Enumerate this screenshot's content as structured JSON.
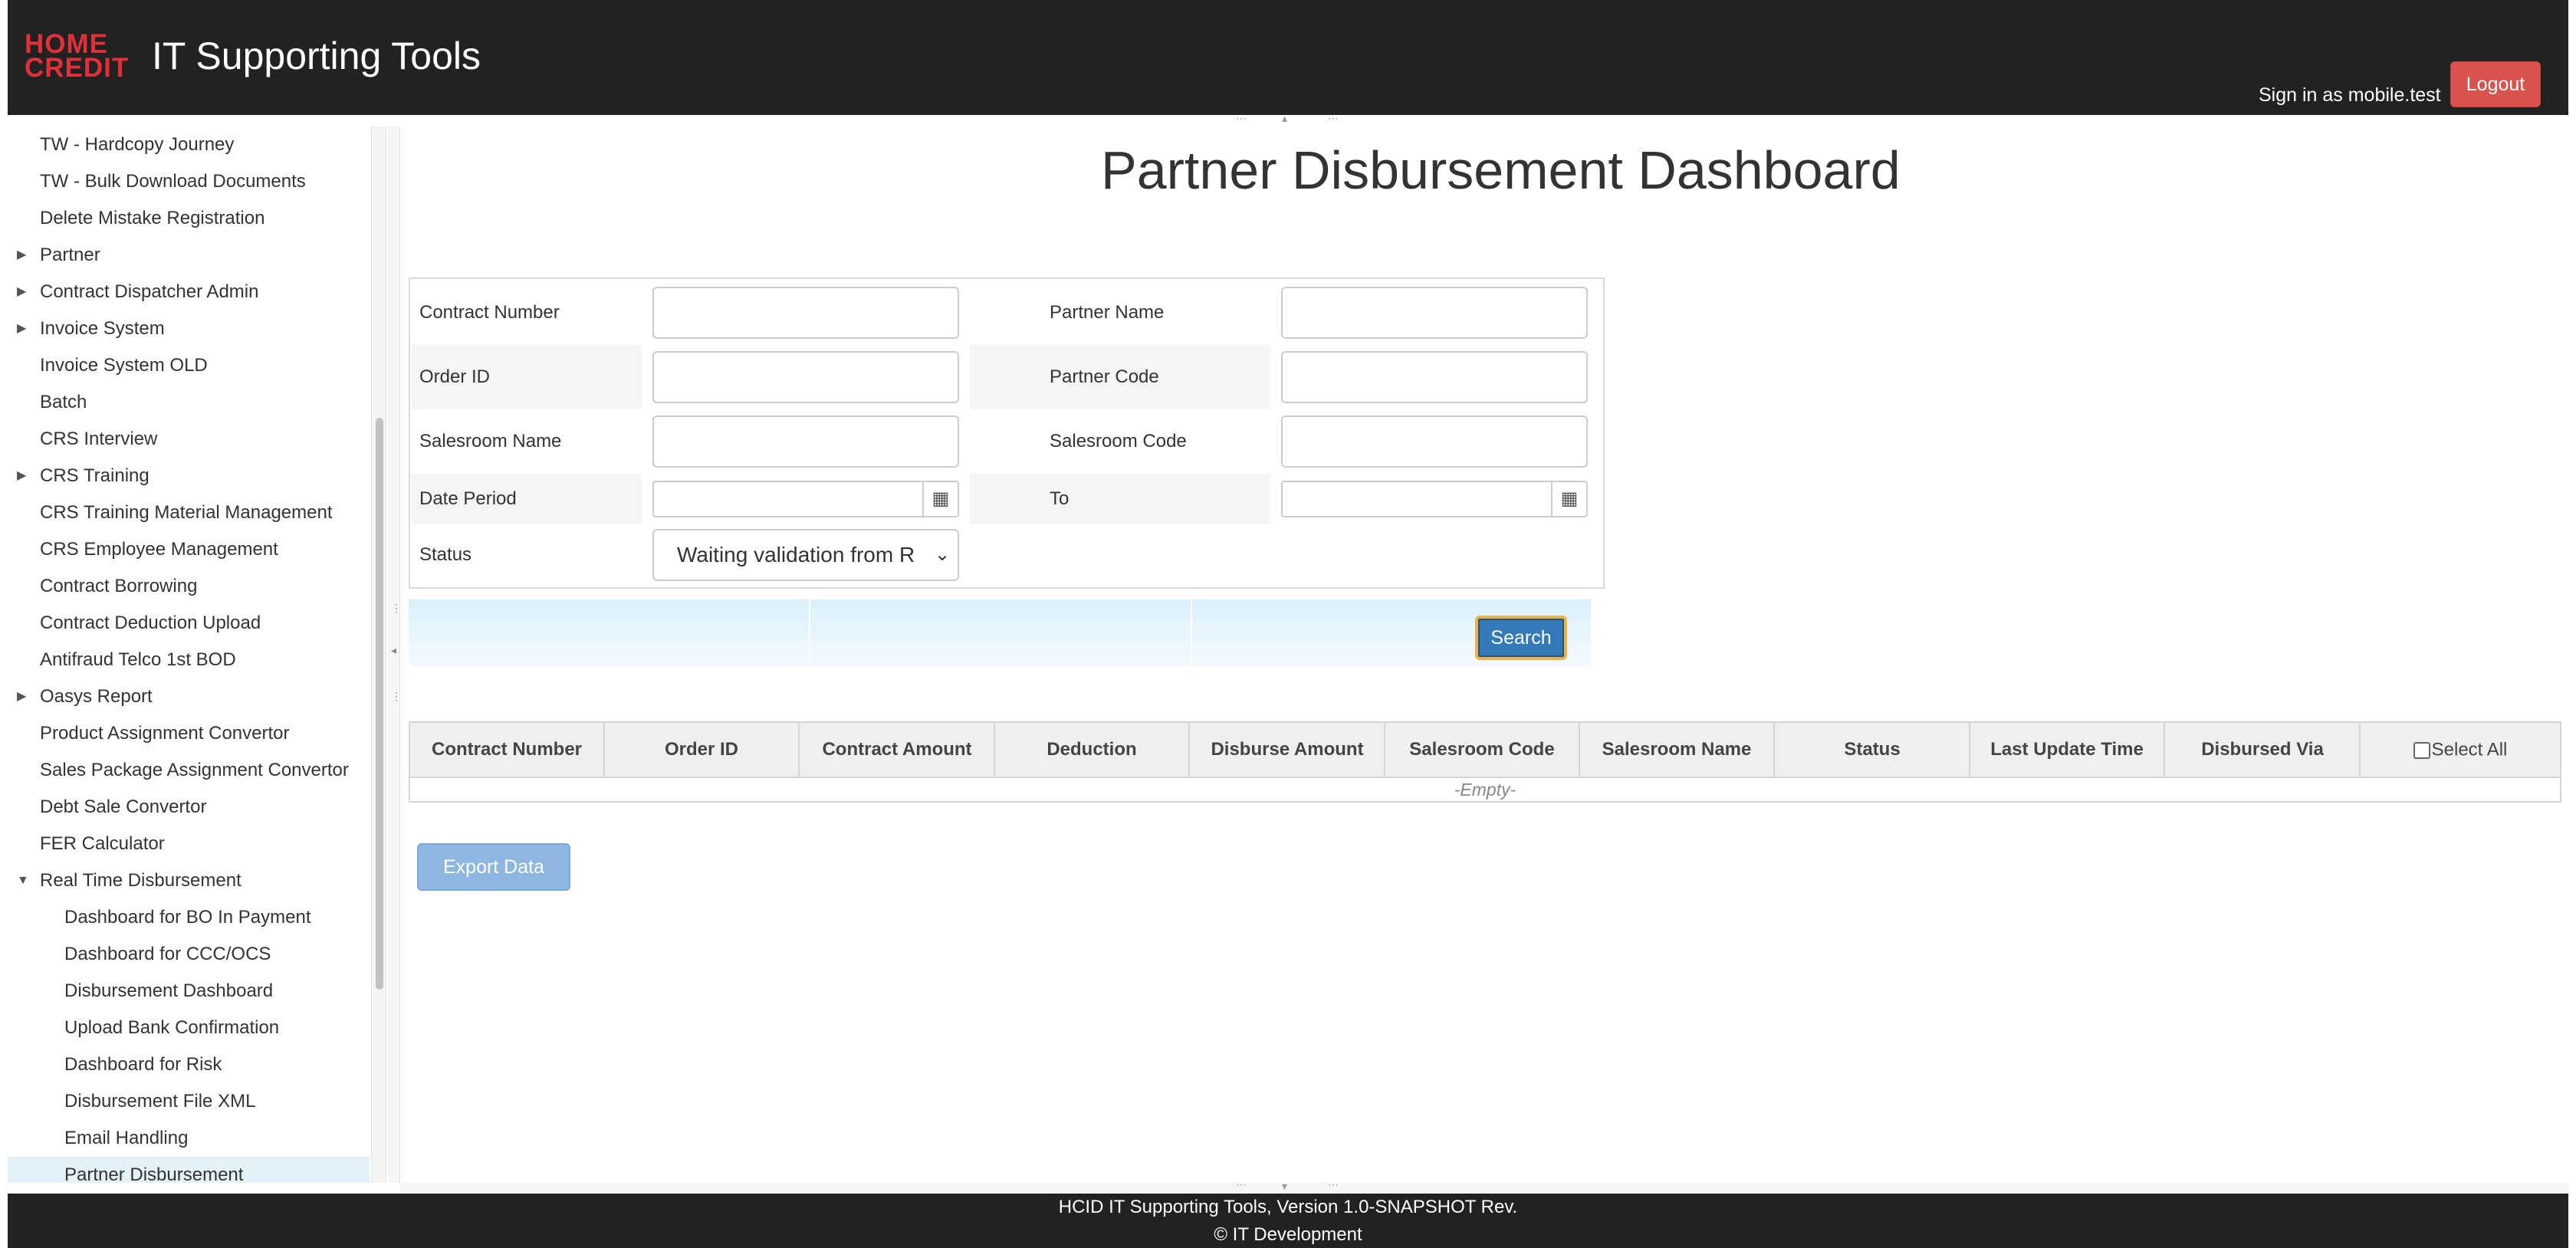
{
  "header": {
    "logo_line1": "HOME",
    "logo_line2": "CREDIT",
    "app_title": "IT Supporting Tools",
    "signin_text": "Sign in as mobile.test",
    "logout_label": "Logout"
  },
  "sidebar": {
    "items": [
      {
        "label": "TW - Hardcopy Journey",
        "expandable": false
      },
      {
        "label": "TW - Bulk Download Documents",
        "expandable": false
      },
      {
        "label": "Delete Mistake Registration",
        "expandable": false
      },
      {
        "label": "Partner",
        "expandable": true
      },
      {
        "label": "Contract Dispatcher Admin",
        "expandable": true
      },
      {
        "label": "Invoice System",
        "expandable": true
      },
      {
        "label": "Invoice System OLD",
        "expandable": false
      },
      {
        "label": "Batch",
        "expandable": false
      },
      {
        "label": "CRS Interview",
        "expandable": false
      },
      {
        "label": "CRS Training",
        "expandable": true
      },
      {
        "label": "CRS Training Material Management",
        "expandable": false
      },
      {
        "label": "CRS Employee Management",
        "expandable": false
      },
      {
        "label": "Contract Borrowing",
        "expandable": false
      },
      {
        "label": "Contract Deduction Upload",
        "expandable": false
      },
      {
        "label": "Antifraud Telco 1st BOD",
        "expandable": false
      },
      {
        "label": "Oasys Report",
        "expandable": true
      },
      {
        "label": "Product Assignment Convertor",
        "expandable": false
      },
      {
        "label": "Sales Package Assignment Convertor",
        "expandable": false
      },
      {
        "label": "Debt Sale Convertor",
        "expandable": false
      },
      {
        "label": "FER Calculator",
        "expandable": false
      },
      {
        "label": "Real Time Disbursement",
        "expandable": true,
        "expanded": true
      },
      {
        "label": "Dashboard for BO In Payment",
        "child": true
      },
      {
        "label": "Dashboard for CCC/OCS",
        "child": true
      },
      {
        "label": "Disbursement Dashboard",
        "child": true
      },
      {
        "label": "Upload Bank Confirmation",
        "child": true
      },
      {
        "label": "Dashboard for Risk",
        "child": true
      },
      {
        "label": "Disbursement File XML",
        "child": true
      },
      {
        "label": "Email Handling",
        "child": true
      },
      {
        "label": "Partner Disbursement",
        "child": true,
        "selected": true
      }
    ]
  },
  "main": {
    "title": "Partner Disbursement Dashboard",
    "form": {
      "contract_number_label": "Contract Number",
      "contract_number_value": "",
      "partner_name_label": "Partner Name",
      "partner_name_value": "",
      "order_id_label": "Order ID",
      "order_id_value": "",
      "partner_code_label": "Partner Code",
      "partner_code_value": "",
      "salesroom_name_label": "Salesroom Name",
      "salesroom_name_value": "",
      "salesroom_code_label": "Salesroom Code",
      "salesroom_code_value": "",
      "date_period_label": "Date Period",
      "date_from_value": "",
      "to_label": "To",
      "date_to_value": "",
      "status_label": "Status",
      "status_selected": "Waiting validation from R"
    },
    "search_label": "Search",
    "grid": {
      "columns": [
        "Contract Number",
        "Order ID",
        "Contract Amount",
        "Deduction",
        "Disburse Amount",
        "Salesroom Code",
        "Salesroom Name",
        "Status",
        "Last Update Time",
        "Disbursed Via"
      ],
      "select_all_label": "Select All",
      "empty_text": "-Empty-"
    },
    "export_label": "Export Data"
  },
  "footer": {
    "line1": "HCID IT Supporting Tools, Version 1.0-SNAPSHOT Rev.",
    "line2": "© IT Development"
  },
  "icons": {
    "expand": "caret-right-icon",
    "collapse": "caret-down-icon",
    "calendar": "calendar-icon",
    "select": "chevron-down-icon"
  },
  "colors": {
    "header_bg": "#222222",
    "brand_red": "#e0313b",
    "logout_bg": "#d9534f",
    "search_bg": "#337ab7",
    "selected_nav_bg": "#e3f1fa"
  }
}
